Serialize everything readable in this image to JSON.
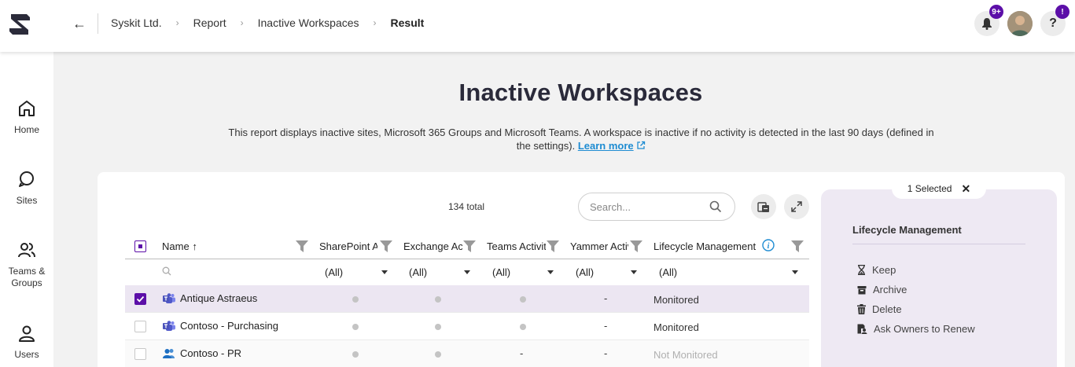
{
  "header": {
    "breadcrumbs": [
      "Syskit Ltd.",
      "Report",
      "Inactive Workspaces"
    ],
    "current": "Result",
    "notifications_badge": "9+",
    "help_badge": "!",
    "help_label": "?"
  },
  "sidebar": {
    "items": [
      {
        "label": "Home",
        "icon": "home-icon"
      },
      {
        "label": "Sites",
        "icon": "sites-icon"
      },
      {
        "label": "Teams & Groups",
        "icon": "teams-groups-icon"
      },
      {
        "label": "Users",
        "icon": "user-icon"
      }
    ]
  },
  "page": {
    "title": "Inactive Workspaces",
    "description": "This report displays inactive sites, Microsoft 365 Groups and Microsoft Teams. A workspace is inactive if no activity is detected in the last 90 days (defined in the settings).",
    "learn_more": "Learn more"
  },
  "toolbar": {
    "total": "134 total",
    "search_placeholder": "Search..."
  },
  "grid": {
    "columns": [
      "Name",
      "SharePoint A",
      "Exchange Act",
      "Teams Activit",
      "Yammer Activ",
      "Lifecycle Management"
    ],
    "filter_values": [
      "(All)",
      "(All)",
      "(All)",
      "(All)",
      "(All)"
    ],
    "rows": [
      {
        "name": "Antique Astraeus",
        "type": "teams",
        "sharepoint": "dot",
        "exchange": "dot",
        "teams": "dot",
        "yammer": "-",
        "lifecycle": "Monitored",
        "selected": true
      },
      {
        "name": "Contoso - Purchasing",
        "type": "teams",
        "sharepoint": "dot",
        "exchange": "dot",
        "teams": "dot",
        "yammer": "-",
        "lifecycle": "Monitored",
        "selected": false
      },
      {
        "name": "Contoso - PR",
        "type": "group",
        "sharepoint": "dot",
        "exchange": "dot",
        "teams": "-",
        "yammer": "-",
        "lifecycle": "Not Monitored",
        "selected": false
      }
    ]
  },
  "panel": {
    "selected_label": "1 Selected",
    "title": "Lifecycle Management",
    "actions": [
      "Keep",
      "Archive",
      "Delete",
      "Ask Owners to Renew"
    ]
  },
  "colors": {
    "accent": "#5c0fa8",
    "link": "#1e8cd2",
    "panel_bg": "#eee9f3"
  }
}
